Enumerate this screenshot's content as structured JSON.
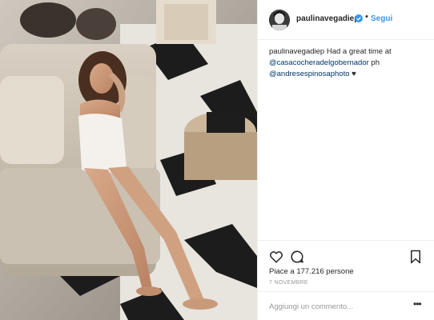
{
  "post": {
    "username": "paulinavegadiep",
    "follow_label": "Segui",
    "separator": "•",
    "caption": {
      "username": "paulinavegadiep",
      "text_1": "Had a great time at",
      "mention_1": "@casacocheradelgobernador",
      "text_2": "ph",
      "mention_2": "@andresespinosaphoto",
      "emoji": "♥"
    },
    "likes_text": "Piace a 177.216 persone",
    "date": "7 NOVEMBRE",
    "comment_placeholder": "Aggiungi un commento...",
    "more_label": "•••"
  },
  "icons": {
    "verified": "verified-badge-icon",
    "like": "heart-icon",
    "comment": "comment-icon",
    "save": "bookmark-icon",
    "more": "more-options-icon"
  },
  "colors": {
    "link_blue": "#3897f0",
    "verified_blue": "#3897f0",
    "mention": "#003569",
    "muted": "#999999"
  }
}
